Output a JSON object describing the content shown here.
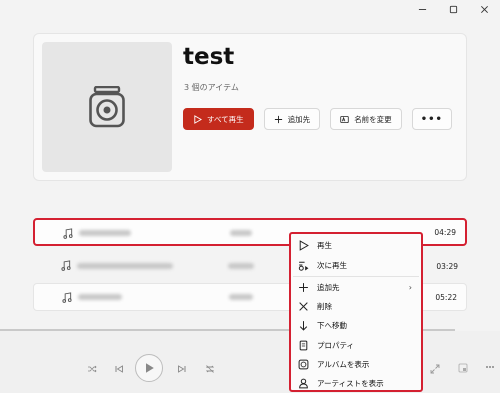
{
  "window": {
    "minimize_icon": "minimize-icon",
    "maximize_icon": "maximize-icon",
    "close_icon": "close-icon"
  },
  "playlist": {
    "title": "test",
    "item_count": "3 個のアイテム",
    "actions": {
      "play_all": "すべて再生",
      "add_to": "追加先",
      "rename": "名前を変更",
      "more": "•••"
    }
  },
  "tracks": [
    {
      "duration": "04:29",
      "selected": true
    },
    {
      "duration": "03:29",
      "selected": false
    },
    {
      "duration": "05:22",
      "selected": false
    }
  ],
  "context_menu": {
    "items": [
      {
        "label": "再生",
        "icon": "play-icon"
      },
      {
        "label": "次に再生",
        "icon": "play-next-icon"
      },
      {
        "label": "追加先",
        "icon": "plus-icon",
        "submenu_arrow": "›"
      },
      {
        "label": "削除",
        "icon": "x-icon"
      },
      {
        "label": "下へ移動",
        "icon": "arrow-down-icon"
      },
      {
        "label": "プロパティ",
        "icon": "properties-icon"
      },
      {
        "label": "アルバムを表示",
        "icon": "album-icon"
      },
      {
        "label": "アーティストを表示",
        "icon": "artist-icon"
      }
    ]
  },
  "colors": {
    "accent": "#c42b1c",
    "highlight_outline": "#d42031"
  }
}
